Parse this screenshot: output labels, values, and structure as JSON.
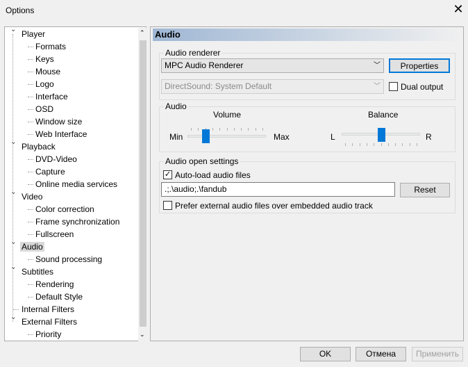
{
  "window": {
    "title": "Options"
  },
  "tree": {
    "items": [
      {
        "label": "Player",
        "level": 0,
        "expanded": true
      },
      {
        "label": "Formats",
        "level": 1
      },
      {
        "label": "Keys",
        "level": 1
      },
      {
        "label": "Mouse",
        "level": 1
      },
      {
        "label": "Logo",
        "level": 1
      },
      {
        "label": "Interface",
        "level": 1
      },
      {
        "label": "OSD",
        "level": 1
      },
      {
        "label": "Window size",
        "level": 1
      },
      {
        "label": "Web Interface",
        "level": 1
      },
      {
        "label": "Playback",
        "level": 0,
        "expanded": true
      },
      {
        "label": "DVD-Video",
        "level": 1
      },
      {
        "label": "Capture",
        "level": 1
      },
      {
        "label": "Online media services",
        "level": 1
      },
      {
        "label": "Video",
        "level": 0,
        "expanded": true
      },
      {
        "label": "Color correction",
        "level": 1
      },
      {
        "label": "Frame synchronization",
        "level": 1
      },
      {
        "label": "Fullscreen",
        "level": 1
      },
      {
        "label": "Audio",
        "level": 0,
        "expanded": true,
        "selected": true
      },
      {
        "label": "Sound processing",
        "level": 1
      },
      {
        "label": "Subtitles",
        "level": 0,
        "expanded": true
      },
      {
        "label": "Rendering",
        "level": 1
      },
      {
        "label": "Default Style",
        "level": 1
      },
      {
        "label": "Internal Filters",
        "level": 0
      },
      {
        "label": "External Filters",
        "level": 0,
        "expanded": true
      },
      {
        "label": "Priority",
        "level": 1
      }
    ]
  },
  "panel": {
    "header": "Audio",
    "renderer": {
      "caption": "Audio renderer",
      "selected": "MPC Audio Renderer",
      "properties": "Properties",
      "device": "DirectSound: System Default",
      "dual_output": "Dual output",
      "dual_checked": false
    },
    "audio": {
      "caption": "Audio",
      "volume_label": "Volume",
      "min": "Min",
      "max": "Max",
      "volume_value": 0.2,
      "balance_label": "Balance",
      "l": "L",
      "r": "R",
      "balance_value": 0.5
    },
    "open": {
      "caption": "Audio open settings",
      "autoload": "Auto-load audio files",
      "autoload_checked": true,
      "paths": ".;.\\audio;.\\fandub",
      "reset": "Reset",
      "prefer": "Prefer external audio files over embedded audio track",
      "prefer_checked": false
    }
  },
  "footer": {
    "ok": "OK",
    "cancel": "Отмена",
    "apply": "Применить"
  }
}
